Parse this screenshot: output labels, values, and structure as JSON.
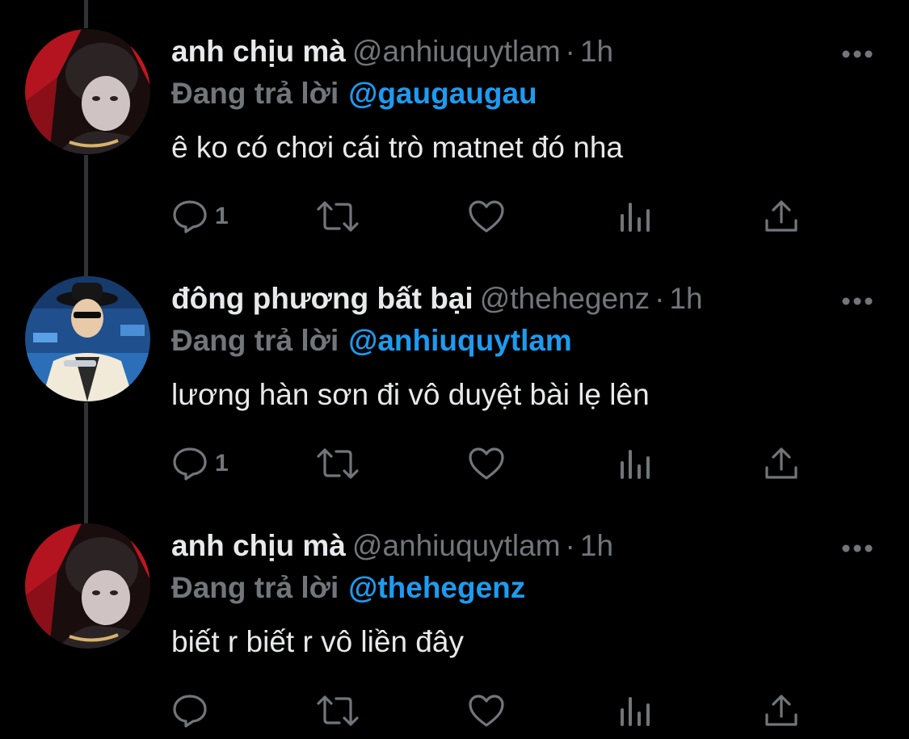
{
  "colors": {
    "background": "#000000",
    "text": "#e7e9ea",
    "muted": "#71767b",
    "accent": "#1d9bf0",
    "thread_line": "#2f3336"
  },
  "tweets": [
    {
      "display_name": "anh chịu mà",
      "handle": "@anhiuquytlam",
      "separator": "·",
      "time": "1h",
      "reply_prefix": "Đang trả lời",
      "reply_to": "@gaugaugau",
      "text": "ê ko có chơi cái trò matnet đó nha",
      "reply_count": "1",
      "icons": [
        "more-icon",
        "reply-icon",
        "retweet-icon",
        "like-icon",
        "views-icon",
        "share-icon"
      ]
    },
    {
      "display_name": "đông phương bất bại",
      "handle": "@thehegenz",
      "separator": "·",
      "time": "1h",
      "reply_prefix": "Đang trả lời",
      "reply_to": "@anhiuquytlam",
      "text": "lương hàn sơn đi vô duyệt bài lẹ lên",
      "reply_count": "1",
      "icons": [
        "more-icon",
        "reply-icon",
        "retweet-icon",
        "like-icon",
        "views-icon",
        "share-icon"
      ]
    },
    {
      "display_name": "anh chịu mà",
      "handle": "@anhiuquytlam",
      "separator": "·",
      "time": "1h",
      "reply_prefix": "Đang trả lời",
      "reply_to": "@thehegenz",
      "text": "biết r biết r vô liền đây",
      "reply_count": "",
      "icons": [
        "more-icon",
        "reply-icon",
        "retweet-icon",
        "like-icon",
        "views-icon",
        "share-icon"
      ]
    }
  ]
}
